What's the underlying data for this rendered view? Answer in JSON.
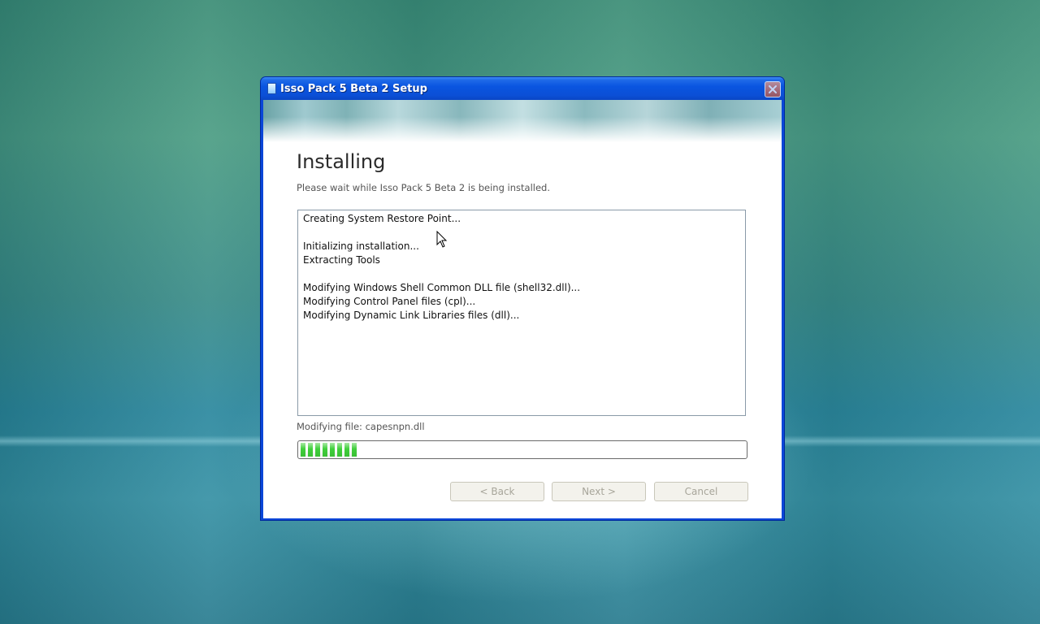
{
  "window": {
    "title": "Isso Pack 5 Beta 2 Setup",
    "icon": "setup-app-icon",
    "close_icon": "close-icon"
  },
  "page": {
    "heading": "Installing",
    "subheading": "Please wait while Isso Pack 5 Beta 2 is being installed."
  },
  "log": {
    "lines": [
      "Creating System Restore Point...",
      "",
      "Initializing installation...",
      "Extracting Tools",
      "",
      "Modifying Windows Shell Common DLL file (shell32.dll)...",
      "Modifying Control Panel files (cpl)...",
      "Modifying Dynamic Link Libraries files (dll)..."
    ]
  },
  "status": {
    "text": "Modifying file: capesnpn.dll",
    "progress_fraction": 0.13,
    "progress_color": "#3fcf3a"
  },
  "buttons": {
    "back": "< Back",
    "next": "Next >",
    "cancel": "Cancel"
  },
  "colors": {
    "titlebar": "#0a55e0",
    "window_border": "#0a46d8"
  }
}
